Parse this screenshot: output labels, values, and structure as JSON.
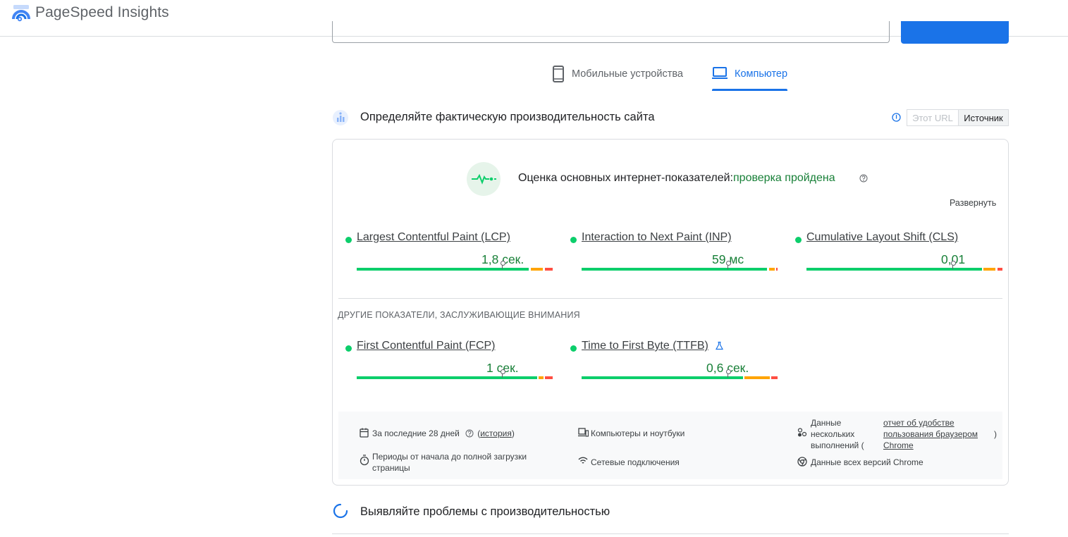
{
  "header": {
    "app_title": "PageSpeed Insights",
    "logo_icon": "pagespeed-logo-icon"
  },
  "device_tabs": [
    {
      "label": "Мобильные устройства",
      "icon": "smartphone-icon",
      "active": false
    },
    {
      "label": "Компьютер",
      "icon": "laptop-icon",
      "active": true
    }
  ],
  "field_section": {
    "title": "Определяйте фактическую производительность сайта",
    "toggle": {
      "options": [
        "Этот URL",
        "Источник"
      ],
      "selected": "Источник"
    }
  },
  "cwv": {
    "assessment_label": "Оценка основных интернет-показателей:",
    "assessment_status": "проверка пройдена",
    "expand_label": "Развернуть"
  },
  "metrics": [
    {
      "name": "Largest Contentful Paint (LCP)",
      "value": "1,8 сек.",
      "status": "good"
    },
    {
      "name": "Interaction to Next Paint (INP)",
      "value": "59 мс",
      "status": "good"
    },
    {
      "name": "Cumulative Layout Shift (CLS)",
      "value": "0,01",
      "status": "good"
    }
  ],
  "other_label": "ДРУГИЕ ПОКАЗАТЕЛИ, ЗАСЛУЖИВАЮЩИЕ ВНИМАНИЯ",
  "other_metrics": [
    {
      "name": "First Contentful Paint (FCP)",
      "value": "1 сек.",
      "status": "good"
    },
    {
      "name": "Time to First Byte (TTFB)",
      "value": "0,6 сек.",
      "status": "good",
      "experimental": true
    }
  ],
  "info": {
    "period": "За последние 28 дней",
    "history_open": "(",
    "history_link": "история",
    "history_close": ")",
    "devices": "Компьютеры и ноутбуки",
    "samples_line1": "Данные",
    "samples_line2": "нескольких",
    "samples_line3": "выполнений (",
    "crux_link1": "отчет об удобстве",
    "crux_link2": "пользования браузером",
    "crux_link3": "Chrome",
    "samples_close": ")",
    "duration_line1": "Периоды от начала до полной загрузки",
    "duration_line2": "страницы",
    "network": "Сетевые подключения",
    "chrome_versions": "Данные всех версий Chrome"
  },
  "lab_section": {
    "title": "Выявляйте проблемы с производительностью"
  },
  "colors": {
    "accent": "#1a73e8",
    "good": "#0cce6b",
    "average": "#ffa400",
    "poor": "#ff4e42",
    "pass_text": "#188038"
  }
}
